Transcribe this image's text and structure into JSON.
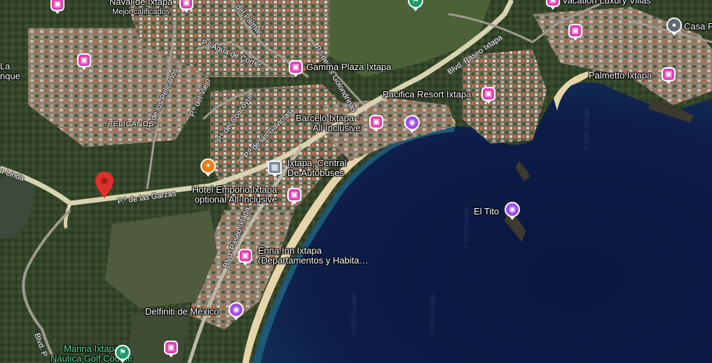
{
  "colors": {
    "hotel_pin": "#e040b5",
    "attraction_pin": "#a04ee6",
    "food_pin": "#f07c17",
    "transit_pin": "#7c8ea3",
    "generic_pin": "#5f6a75",
    "red_pin": "#e0302b",
    "golf_pin": "#1e9c6a",
    "sea_deep": "#0c1a3e",
    "sea_shallow": "#1d5878",
    "beach": "#e6d4aa"
  },
  "places": {
    "naval": {
      "name": "Naval de Ixtapa",
      "sub": "Mejor calificados",
      "icon": "bed-icon"
    },
    "gamma": {
      "name": "Gamma Plaza Ixtapa",
      "icon": "bed-icon"
    },
    "pacifica": {
      "name": "Pacifica Resort Ixtapa",
      "icon": "bed-icon"
    },
    "barcelo": {
      "name1": "Barceló Ixtapa -",
      "name2": "All Inclusive",
      "icon": "bed-icon"
    },
    "central": {
      "name1": "Ixtapa, Central",
      "name2": "De Autobuses",
      "icon": "bus-icon"
    },
    "emporio": {
      "name1": "Hotel Emporio Ixtapa",
      "name2": "optional All-Inclusive",
      "icon": "bed-icon"
    },
    "el_tito": {
      "name": "El Tito",
      "icon": "camera-icon"
    },
    "enna": {
      "name1": "Enna Inn Ixtapa",
      "name2": "(Departamentos y Habita…",
      "icon": "bed-icon"
    },
    "delfiniti": {
      "name": "Delfiniti de México",
      "icon": "camera-icon"
    },
    "marina": {
      "name1": "Marina Ixtapa",
      "name2": "Náutica Golf Course",
      "icon": "golf-icon"
    },
    "palmetto": {
      "name": "Palmetto Ixtapa",
      "icon": "bed-icon"
    },
    "vacation": {
      "name": "Vacation Luxury Villas",
      "icon": "bed-icon"
    },
    "casa": {
      "name": "Casa F",
      "icon": "pin-icon"
    },
    "la_laguna": {
      "name1": "La",
      "name2": "nque"
    },
    "pelicanos": {
      "name": "PELICANOS I"
    }
  },
  "roads": {
    "garzas": "P.º de las Garzas",
    "paseo_ixtapa_top": "Blvd. Paseo Ixtapa",
    "paseo_ixtapa_mid": "Blvd. Paseo Ixtapa",
    "pelicanos": "P.º de los Pelicanos",
    "viejo": "P.º del Viejo",
    "agua_de_correr": "P.º Agua de Correr",
    "coacoyul": "P.º del Coacoyul",
    "gaviotas": "P.º de las Gaviotas",
    "palmar": "del Palmar",
    "golondrinas": "P.º de las Golondrinas",
    "linda": "a Linda",
    "blvd_left": "Blvd. P"
  },
  "watermark": "© 2025 Google"
}
